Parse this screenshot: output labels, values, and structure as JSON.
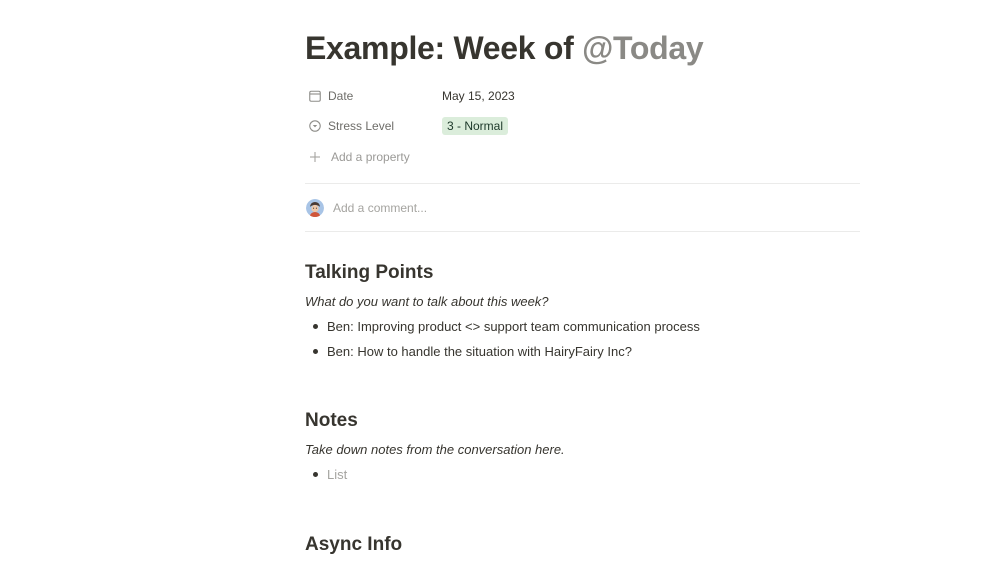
{
  "title": {
    "prefix": "Example: Week of ",
    "mention": "@Today"
  },
  "properties": [
    {
      "name": "Date",
      "icon": "calendar-icon",
      "value": "May 15, 2023"
    },
    {
      "name": "Stress Level",
      "icon": "select-icon",
      "value": "3 - Normal",
      "tag_color": "#dbeddb"
    }
  ],
  "add_property_label": "Add a property",
  "comment": {
    "placeholder": "Add a comment..."
  },
  "sections": {
    "talking_points": {
      "heading": "Talking Points",
      "hint": "What do you want to talk about this week?",
      "items": [
        "Ben: Improving product <> support team communication process",
        "Ben: How to handle the situation with HairyFairy Inc?"
      ]
    },
    "notes": {
      "heading": "Notes",
      "hint": "Take down notes from the conversation here.",
      "items": [
        "List"
      ]
    },
    "async_info": {
      "heading": "Async Info"
    }
  }
}
